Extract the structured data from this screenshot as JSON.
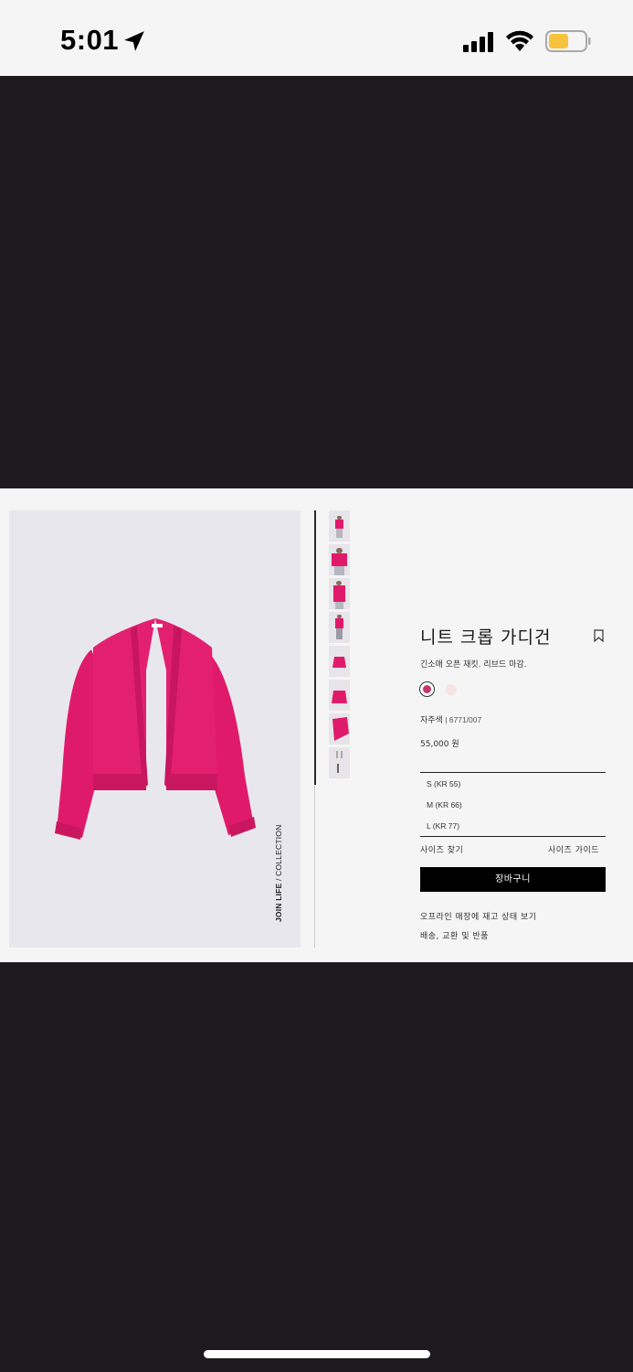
{
  "status_bar": {
    "time": "5:01",
    "icons": [
      "location-arrow-icon",
      "cellular-signal-icon",
      "wifi-icon",
      "battery-icon"
    ],
    "battery_color": "#f7c23c"
  },
  "product": {
    "image_side_text_bold": "JOIN LIFE",
    "image_side_text": " / COLLECTION",
    "title": "니트 크롭 가디건",
    "subtitle": "긴소매 오픈 재킷. 리브드 마감.",
    "color_name": "자주색",
    "color_code": " | 6771/007",
    "price": "55,000 원",
    "sizes": [
      "S (KR 55)",
      "M (KR 66)",
      "L (KR 77)"
    ],
    "size_find": "사이즈 찾기",
    "size_guide": "사이즈 가이드",
    "add_to_cart": "장바구니",
    "store_stock": "오프라인 매장에 재고 상태 보기",
    "shipping": "배송, 교환 및 반품",
    "colors": {
      "selected": "#c2366b",
      "other": "#f6e4e0",
      "garment": "#e01a6a"
    }
  }
}
